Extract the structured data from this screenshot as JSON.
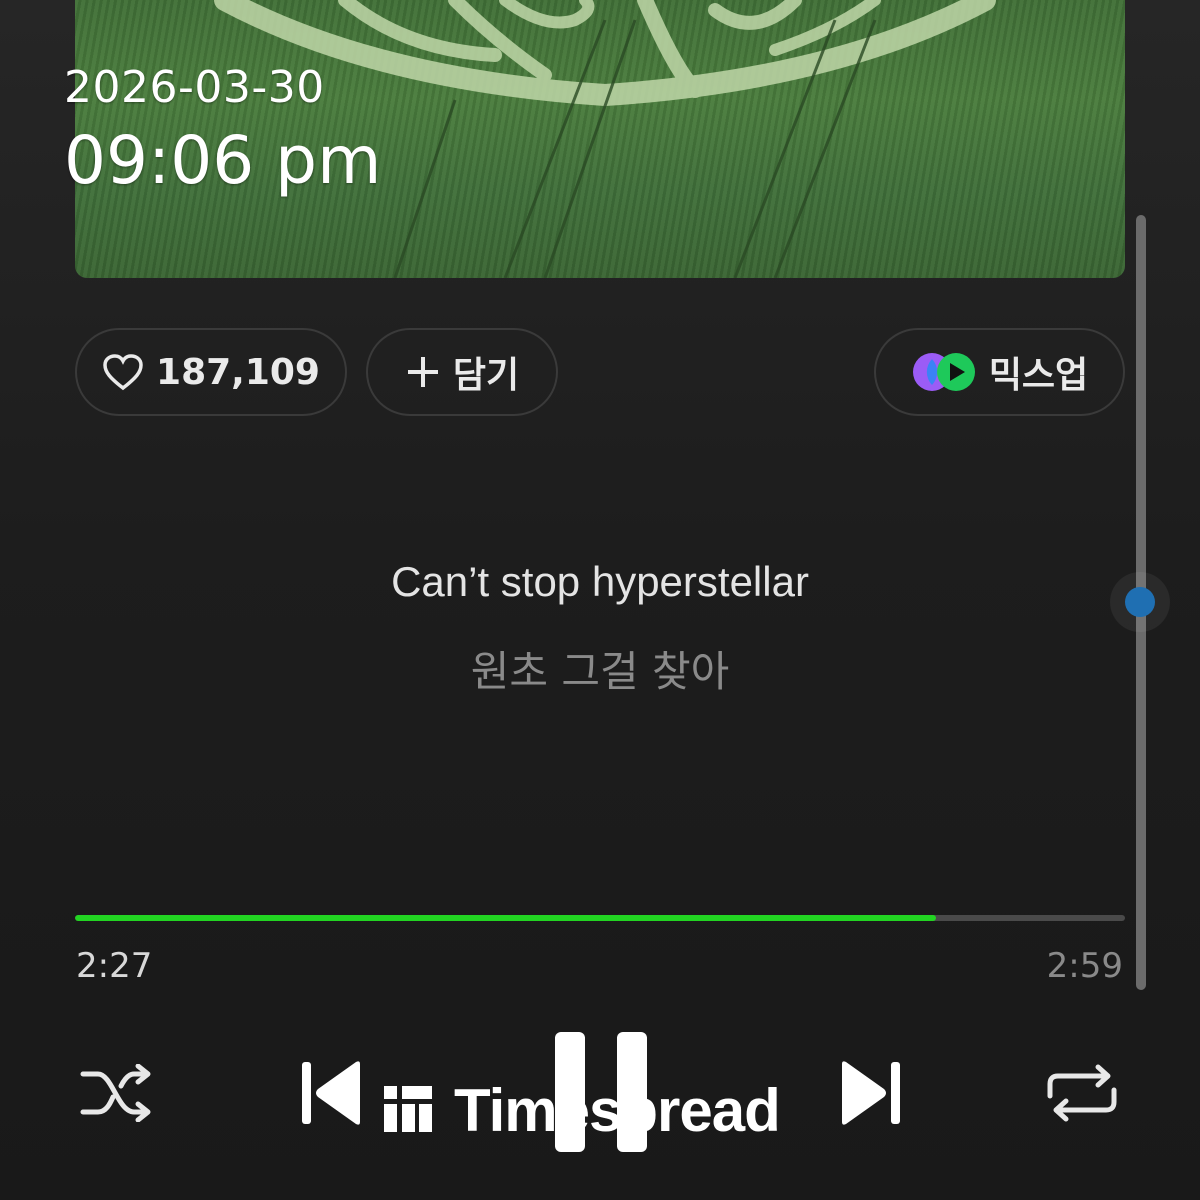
{
  "overlay": {
    "date": "2026-03-30",
    "time": "09:06 pm"
  },
  "actions": {
    "like_count": "187,109",
    "add_label": "담기",
    "mixup_label": "믹스업"
  },
  "lyrics": {
    "current": "Can’t stop hyperstellar",
    "next": "원초 그걸 찾아"
  },
  "playback": {
    "elapsed": "2:27",
    "duration": "2:59",
    "progress_fraction": 0.82,
    "state": "playing"
  },
  "controls": [
    "shuffle-icon",
    "previous-icon",
    "pause-icon",
    "next-icon",
    "repeat-icon"
  ],
  "watermark": {
    "text": "Timespread"
  },
  "colors": {
    "accent_green": "#22d422",
    "scroll_dot": "#1f6fb2",
    "background": "#1d1d1d"
  }
}
